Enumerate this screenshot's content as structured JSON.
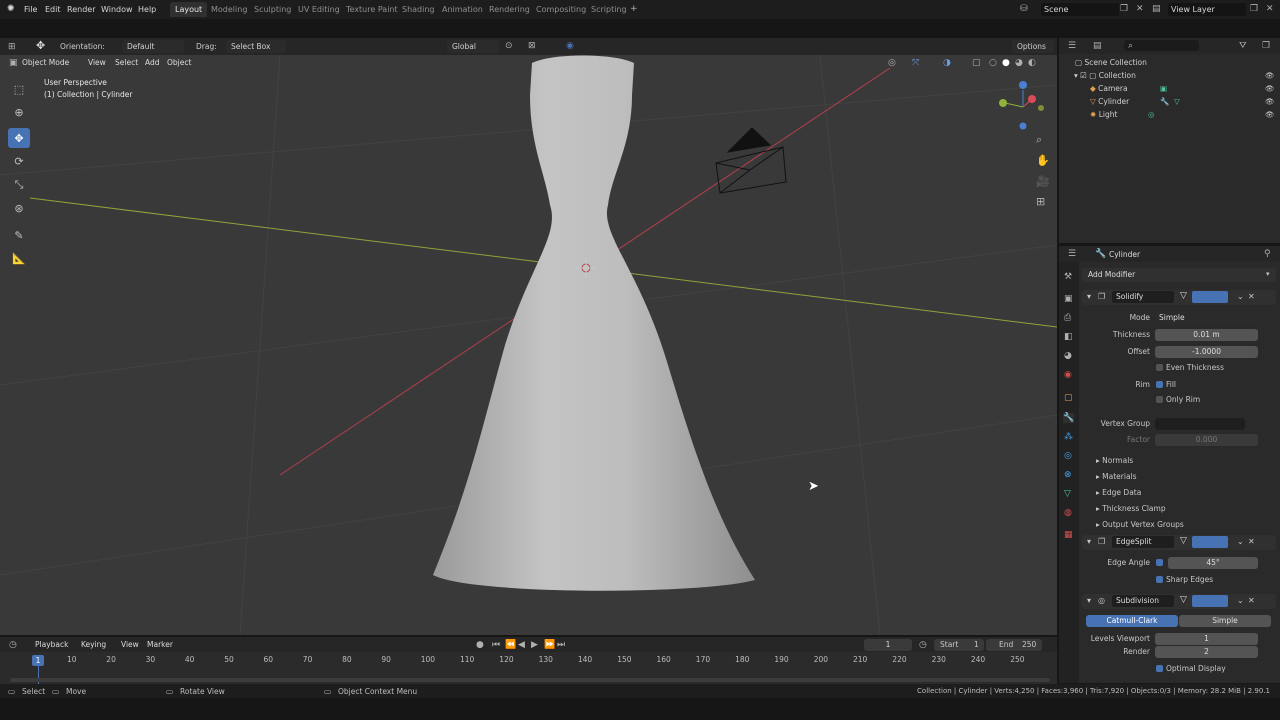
{
  "topbar": {
    "menus": [
      "File",
      "Edit",
      "Render",
      "Window",
      "Help"
    ],
    "workspaces": [
      "Layout",
      "Modeling",
      "Sculpting",
      "UV Editing",
      "Texture Paint",
      "Shading",
      "Animation",
      "Rendering",
      "Compositing",
      "Scripting"
    ],
    "active_workspace": "Layout",
    "scene": "Scene",
    "view_layer": "View Layer"
  },
  "toolheader": {
    "orientation_label": "Orientation:",
    "orientation_value": "Default",
    "drag_label": "Drag:",
    "drag_value": "Select Box",
    "transform_orientation": "Global",
    "options": "Options"
  },
  "viewport_header": {
    "mode": "Object Mode",
    "menus": [
      "View",
      "Select",
      "Add",
      "Object"
    ]
  },
  "viewport": {
    "perspective": "User Perspective",
    "collection_info": "(1) Collection | Cylinder"
  },
  "outliner": {
    "scene_collection": "Scene Collection",
    "collection": "Collection",
    "items": [
      "Camera",
      "Cylinder",
      "Light"
    ]
  },
  "properties": {
    "object_name": "Cylinder",
    "add_modifier": "Add Modifier",
    "solidify": {
      "name": "Solidify",
      "mode_label": "Mode",
      "mode_value": "Simple",
      "thickness_label": "Thickness",
      "thickness_value": "0.01 m",
      "offset_label": "Offset",
      "offset_value": "-1.0000",
      "even_thickness": "Even Thickness",
      "rim_label": "Rim",
      "fill": "Fill",
      "only_rim": "Only Rim",
      "vertex_group_label": "Vertex Group",
      "factor_label": "Factor",
      "factor_value": "0.000",
      "subpanels": [
        "Normals",
        "Materials",
        "Edge Data",
        "Thickness Clamp",
        "Output Vertex Groups"
      ]
    },
    "edgesplit": {
      "name": "EdgeSplit",
      "edge_angle_label": "Edge Angle",
      "edge_angle_value": "45°",
      "sharp_edges": "Sharp Edges"
    },
    "subdivision": {
      "name": "Subdivision",
      "catmull_clark": "Catmull-Clark",
      "simple": "Simple",
      "levels_viewport_label": "Levels Viewport",
      "levels_viewport_value": "1",
      "render_label": "Render",
      "render_value": "2",
      "optimal_display": "Optimal Display"
    }
  },
  "timeline": {
    "menus": [
      "Playback",
      "Keying",
      "View",
      "Marker"
    ],
    "current_frame": "1",
    "start_label": "Start",
    "start_value": "1",
    "end_label": "End",
    "end_value": "250",
    "ticks": [
      "10",
      "20",
      "30",
      "40",
      "50",
      "60",
      "70",
      "80",
      "90",
      "100",
      "110",
      "120",
      "130",
      "140",
      "150",
      "160",
      "170",
      "180",
      "190",
      "200",
      "210",
      "220",
      "230",
      "240",
      "250"
    ],
    "frame_marker": "1"
  },
  "statusbar": {
    "select": "Select",
    "move": "Move",
    "rotate_view": "Rotate View",
    "context_menu": "Object Context Menu",
    "stats": "Collection | Cylinder | Verts:4,250 | Faces:3,960 | Tris:7,920 | Objects:0/3 | Memory: 28.2 MiB | 2.90.1"
  },
  "colors": {
    "accent": "#4772b3",
    "viewport_bg": "#393939",
    "x_axis": "#b3404e",
    "y_axis": "#8fa33a"
  }
}
